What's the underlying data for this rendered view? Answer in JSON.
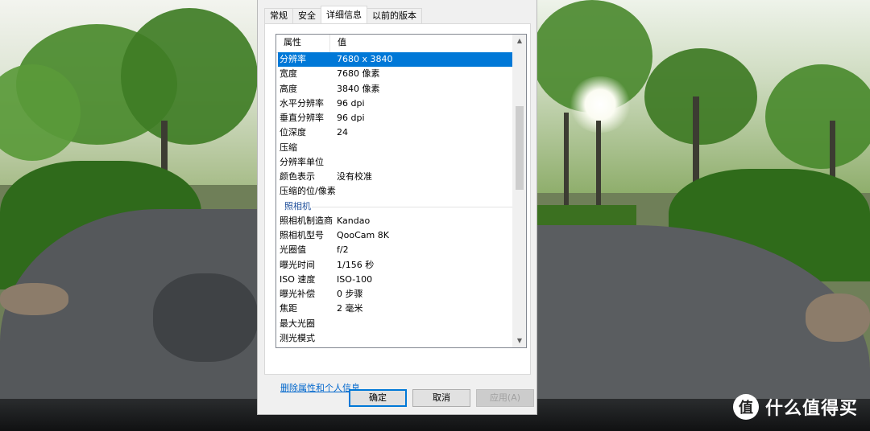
{
  "tabs": [
    {
      "label": "常规",
      "active": false
    },
    {
      "label": "安全",
      "active": false
    },
    {
      "label": "详细信息",
      "active": true
    },
    {
      "label": "以前的版本",
      "active": false
    }
  ],
  "table": {
    "header": {
      "property": "属性",
      "value": "值"
    },
    "rows": [
      {
        "property": "分辨率",
        "value": "7680 x 3840",
        "selected": true
      },
      {
        "property": "宽度",
        "value": "7680 像素"
      },
      {
        "property": "高度",
        "value": "3840 像素"
      },
      {
        "property": "水平分辨率",
        "value": "96 dpi"
      },
      {
        "property": "垂直分辨率",
        "value": "96 dpi"
      },
      {
        "property": "位深度",
        "value": "24"
      },
      {
        "property": "压缩",
        "value": ""
      },
      {
        "property": "分辨率单位",
        "value": ""
      },
      {
        "property": "颜色表示",
        "value": "没有校准"
      },
      {
        "property": "压缩的位/像素",
        "value": ""
      },
      {
        "group": "照相机"
      },
      {
        "property": "照相机制造商",
        "value": "Kandao"
      },
      {
        "property": "照相机型号",
        "value": "QooCam 8K"
      },
      {
        "property": "光圈值",
        "value": "f/2"
      },
      {
        "property": "曝光时间",
        "value": "1/156 秒"
      },
      {
        "property": "ISO 速度",
        "value": "ISO-100"
      },
      {
        "property": "曝光补偿",
        "value": "0 步骤"
      },
      {
        "property": "焦距",
        "value": "2 毫米"
      },
      {
        "property": "最大光圈",
        "value": ""
      },
      {
        "property": "测光模式",
        "value": ""
      }
    ]
  },
  "scrollbar": {
    "up_icon": "▲",
    "down_icon": "▼"
  },
  "remove_link": "删除属性和个人信息",
  "buttons": {
    "ok": "确定",
    "cancel": "取消",
    "apply": "应用(A)"
  },
  "watermark": {
    "logo": "值",
    "text": "什么值得买"
  },
  "colors": {
    "selection": "#0078d7",
    "link": "#0066cc",
    "group_text": "#1e4e9a"
  }
}
